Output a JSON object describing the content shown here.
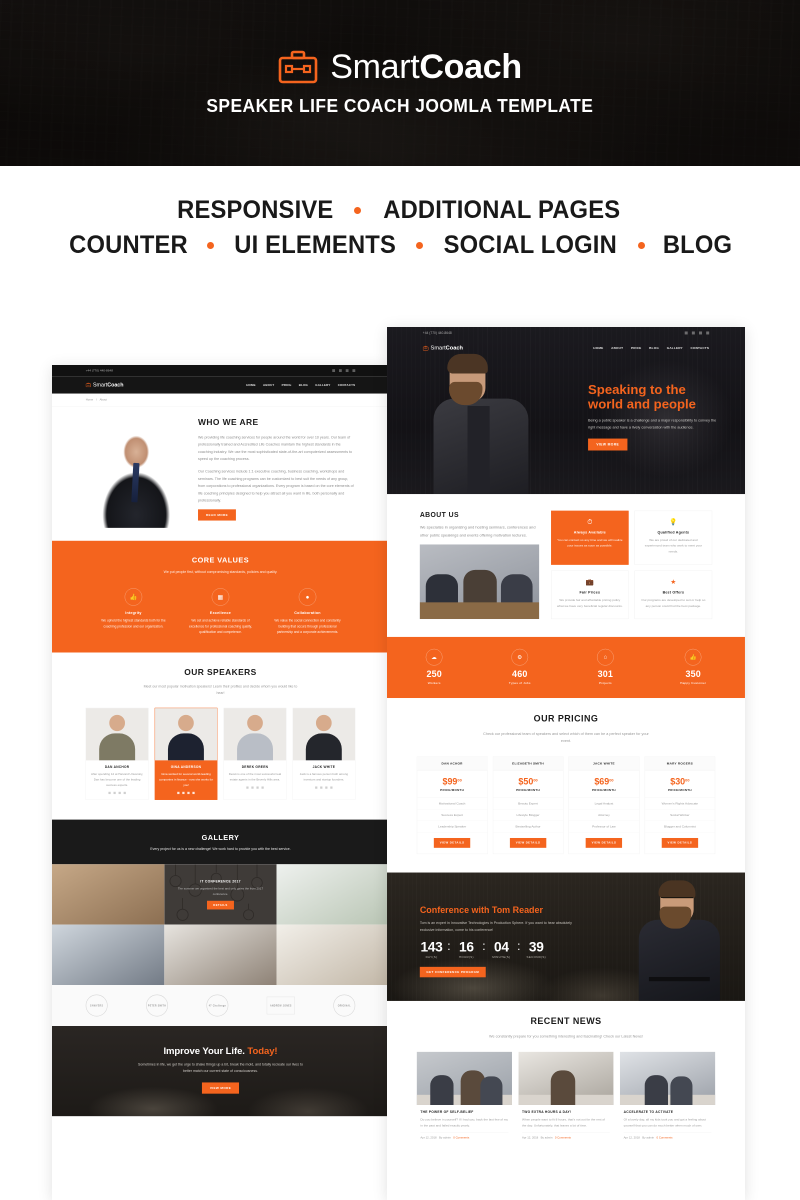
{
  "banner": {
    "logo_icon": "briefcase-icon",
    "logo_thin": "Smart",
    "logo_bold": "Coach",
    "subtitle": "SPEAKER LIFE COACH JOOMLA TEMPLATE",
    "accent_color": "#f4641e",
    "background_color": "#0d0b0a"
  },
  "features": {
    "row1": [
      "RESPONSIVE",
      "ADDITIONAL PAGES"
    ],
    "row2": [
      "COUNTER",
      "UI ELEMENTS",
      "SOCIAL LOGIN",
      "BLOG"
    ]
  },
  "preview_left": {
    "topbar": {
      "phone": "+44 (770) 440-8648"
    },
    "nav": {
      "logo_thin": "Smart",
      "logo_bold": "Coach",
      "items": [
        "HOME",
        "ABOUT",
        "PRICE",
        "BLOG",
        "GALLERY",
        "CONTACTS"
      ]
    },
    "breadcrumb": [
      "Home",
      "About"
    ],
    "who": {
      "title": "WHO WE ARE",
      "p1": "We providing life coaching services for people around the world for over 10 years. Our team of professionally trained and Accredited Life Coaches maintain the highest standards in the coaching industry. We use the most sophisticated state-of-the-art computerized assessments to speed up the coaching process.",
      "p2": "Our Coaching services include 1:1 executive coaching, business coaching, workshops and seminars. The life coaching programs can be customized to best suit the needs of any group, from corporations to professional organizations. Every program is based on the core elements of life coaching principles designed to help you attract all you want in life, both personally and professionally.",
      "button": "READ MORE"
    },
    "core_values": {
      "title": "CORE VALUES",
      "subtitle": "We put people first, without compromising standards, policies and quality.",
      "items": [
        {
          "icon": "thumbs-up-icon",
          "name": "Integrity",
          "text": "We uphold the highest standards both for the coaching profession and our organization."
        },
        {
          "icon": "grid-icon",
          "name": "Excellence",
          "text": "We set and achieve reliable standards of excellence for professional coaching quality, qualification and competence."
        },
        {
          "icon": "drop-icon",
          "name": "Collaboration",
          "text": "We value the social connection and constantly building that occurs through professional partnership and a corporate achievements."
        }
      ]
    },
    "speakers": {
      "title": "OUR SPEAKERS",
      "subtitle": "Meet our most popular motivation speakers! Learn their profiles and decide whom you would like to hear!",
      "cards": [
        {
          "name": "DAN ANCHOR",
          "text": "After spending 12 at Harvard University, Dan has become one of the leading success experts."
        },
        {
          "name": "GINA ANDERSON",
          "text": "Gina worked for several world-leading companies in finance - now she works for you!"
        },
        {
          "name": "DEREK GREEN",
          "text": "Derek is one of the most successful real estate agents in the Beverly Hills area."
        },
        {
          "name": "JACK WHITE",
          "text": "Jack is a famous person both among investors and startup founders."
        }
      ]
    },
    "gallery": {
      "title": "GALLERY",
      "subtitle": "Every project for us is a new challenge! We work hard to provide you with the best service.",
      "overlay_title": "IT CONFERENCE 2017",
      "overlay_text": "The summer we organized the best and only gates the from 2017 conference.",
      "overlay_button": "DETAILS"
    },
    "partners": [
      "SAWYERS",
      "PETER SMITH",
      "47 Challenge",
      "ANDREW JONES",
      "ORIGINAL"
    ],
    "cta": {
      "title_plain": "Improve Your Life.",
      "title_accent": "Today!",
      "text": "Sometimes in life, we get the urge to shake things up a bit, break the mold, and totally recreate our lives to better match our current state of consciousness.",
      "button": "VIEW MORE"
    }
  },
  "preview_right": {
    "topbar": {
      "phone": "+44 (770) 440-8648"
    },
    "nav": {
      "logo_thin": "Smart",
      "logo_bold": "Coach",
      "items": [
        "HOME",
        "ABOUT",
        "PRICE",
        "BLOG",
        "GALLERY",
        "CONTACTS"
      ]
    },
    "hero": {
      "title_accent": "Speaking",
      "title_rest": " to the",
      "title_line2": "world and people",
      "text": "Being a public speaker is a challenge and a major responsibility to convey the right message and have a lively conversation with the audience.",
      "button": "VIEW MORE"
    },
    "about": {
      "title": "ABOUT US",
      "text": "We specialize in organizing and hosting seminars, conferences and other public speakings and events offering motivation lectures.",
      "cards": [
        {
          "icon": "clock-icon",
          "title": "Always Available",
          "text": "You can contact us any time and we will realize your issues as soon as possible."
        },
        {
          "icon": "bulb-icon",
          "title": "Qualified Agents",
          "text": "We are proud of our dedicated and experienced team who work to meet your needs."
        },
        {
          "icon": "bag-icon",
          "title": "Fair Prices",
          "text": "We provide fair and affordable pricing policy what we have very beneficial regular discounts."
        },
        {
          "icon": "star-icon",
          "title": "Best Offers",
          "text": "Our programs are developed to suit or help so any person could find the best package."
        }
      ]
    },
    "counters": [
      {
        "icon": "cloud-icon",
        "value": "250",
        "label": "Workers"
      },
      {
        "icon": "gear-icon",
        "value": "460",
        "label": "Types of Jobs"
      },
      {
        "icon": "home-icon",
        "value": "301",
        "label": "Projects"
      },
      {
        "icon": "thumbs-up-icon",
        "value": "350",
        "label": "Happy Customer"
      }
    ],
    "pricing": {
      "title": "OUR PRICING",
      "subtitle": "Check our professional team of speakers and select which of them can be a perfect speaker for your event.",
      "plans": [
        {
          "name": "DAN ACHOR",
          "price": "$99",
          "cents": "00",
          "per": "PRICE/MONTH",
          "features": [
            "Motivational Coach",
            "Success Expert",
            "Leadership Speaker"
          ],
          "button": "VIEW DETAILS"
        },
        {
          "name": "ELIZABETH SMITH",
          "price": "$50",
          "cents": "00",
          "per": "PRICE/MONTH",
          "features": [
            "Beauty Expert",
            "Lifestyle Blogger",
            "Bestselling Author"
          ],
          "button": "VIEW DETAILS"
        },
        {
          "name": "JACK WHITE",
          "price": "$69",
          "cents": "00",
          "per": "PRICE/MONTH",
          "features": [
            "Legal Analyst",
            "Attorney",
            "Professor of Law"
          ],
          "button": "VIEW DETAILS"
        },
        {
          "name": "MARY ROGERS",
          "price": "$30",
          "cents": "00",
          "per": "PRICE/MONTH",
          "features": [
            "Women's Rights Advocate",
            "Social Worker",
            "Blogger and Columnist"
          ],
          "button": "VIEW DETAILS"
        }
      ]
    },
    "countdown": {
      "title_plain": "Conference with ",
      "title_accent": "Tom Reader",
      "text": "Tom is an expert in Innovative Technologies in Production Sphere. If you want to hear absolutely exclusive information, come to his conference!",
      "units": [
        {
          "value": "143",
          "label": "DAY(S)"
        },
        {
          "value": "16",
          "label": "HOUR(S)"
        },
        {
          "value": "04",
          "label": "MINUTE(S)"
        },
        {
          "value": "39",
          "label": "SECOND(S)"
        }
      ],
      "separator": ":",
      "button": "GET CONFERENCE PROGRAM"
    },
    "news": {
      "title": "RECENT NEWS",
      "subtitle": "We constantly prepare for you something interesting and fascinating! Check our Latest News!",
      "posts": [
        {
          "title": "THE POWER OF SELF-BELIEF",
          "text": "Do you believe in yourself? If I had you, back the last few of my in the past and failed exactly yearly.",
          "date": "Apr 12, 2018",
          "author": "By admin",
          "comments": "0 Comments"
        },
        {
          "title": "TWO EXTRA HOURS A DAY!",
          "text": "When people want to fit 8 hours, that's not out for the rest of the day. Unfortunately, that leaves a lot of time.",
          "date": "Apr 12, 2018",
          "author": "By admin",
          "comments": "0 Comments"
        },
        {
          "title": "ACCELERATE TO ACTIVATE",
          "text": "Of a lovely day, all my kids took you and got a feeling about yourself that you can do much better when much of own.",
          "date": "Apr 12, 2018",
          "author": "By admin",
          "comments": "0 Comments"
        }
      ]
    }
  }
}
